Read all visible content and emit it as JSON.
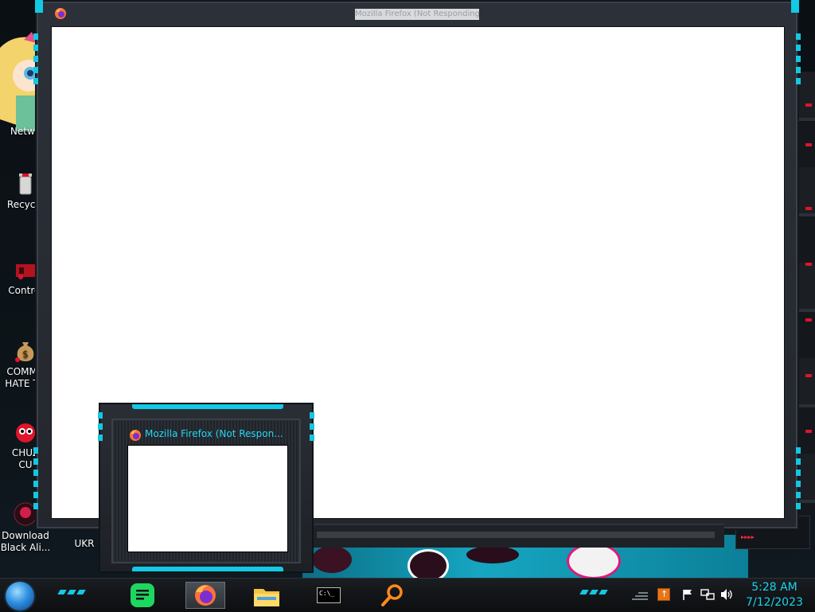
{
  "desktop": {
    "icons": [
      {
        "label": "Netwo",
        "icon": "network-icon"
      },
      {
        "label": "Recycle",
        "icon": "recycle-bin-icon"
      },
      {
        "label": "Control",
        "icon": "control-panel-icon"
      },
      {
        "label": "COMMU\nHATE TH",
        "icon": "money-bag-icon"
      },
      {
        "label": "CHUZ\nCU",
        "icon": "red-character-icon"
      },
      {
        "label": "Download\nBlack Ali...",
        "icon": "app-icon"
      },
      {
        "label": "UKR",
        "icon": "app-icon"
      }
    ]
  },
  "firefox_window": {
    "title": "Mozilla Firefox (Not Responding)"
  },
  "taskbar_preview": {
    "title": "Mozilla Firefox (Not Respon..."
  },
  "taskbar": {
    "pinned": [
      {
        "name": "spotify",
        "icon": "spotify-icon",
        "active": false
      },
      {
        "name": "firefox",
        "icon": "firefox-icon",
        "active": true
      },
      {
        "name": "file-explorer",
        "icon": "folder-icon",
        "active": false
      },
      {
        "name": "command-prompt",
        "icon": "terminal-icon",
        "active": false
      },
      {
        "name": "search",
        "icon": "search-icon",
        "active": false
      }
    ],
    "cmd_prompt_text": "C:\\_"
  },
  "tray": {
    "icons": [
      "show-hidden-icon",
      "java-update-icon",
      "action-center-flag-icon",
      "network-icon",
      "volume-icon"
    ]
  },
  "clock": {
    "time": "5:28 AM",
    "date": "7/12/2023"
  },
  "colors": {
    "accent_cyan": "#12c9e6",
    "accent_red": "#e0142b",
    "frame_dark": "#23272d",
    "clock_text": "#19d3ef"
  }
}
